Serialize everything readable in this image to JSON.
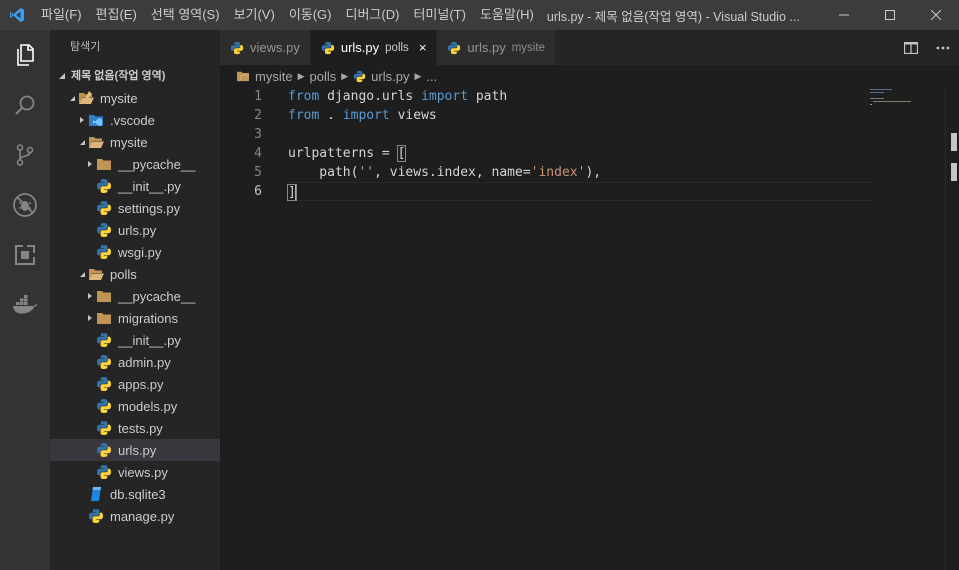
{
  "menu": [
    "파일(F)",
    "편집(E)",
    "선택 영역(S)",
    "보기(V)",
    "이동(G)",
    "디버그(D)",
    "터미널(T)",
    "도움말(H)"
  ],
  "window_title": "urls.py - 제목 없음(작업 영역) - Visual Studio ...",
  "sidebar": {
    "header": "탐색기",
    "workspace": "제목 없음(작업 영역)",
    "tree": [
      {
        "label": "mysite",
        "indent": 0,
        "type": "root",
        "expanded": true
      },
      {
        "label": ".vscode",
        "indent": 1,
        "type": "vscode-folder",
        "expanded": false
      },
      {
        "label": "mysite",
        "indent": 1,
        "type": "folder",
        "expanded": true
      },
      {
        "label": "__pycache__",
        "indent": 2,
        "type": "folder",
        "expanded": false
      },
      {
        "label": "__init__.py",
        "indent": 2,
        "type": "python"
      },
      {
        "label": "settings.py",
        "indent": 2,
        "type": "python"
      },
      {
        "label": "urls.py",
        "indent": 2,
        "type": "python"
      },
      {
        "label": "wsgi.py",
        "indent": 2,
        "type": "python"
      },
      {
        "label": "polls",
        "indent": 1,
        "type": "folder",
        "expanded": true
      },
      {
        "label": "__pycache__",
        "indent": 2,
        "type": "folder",
        "expanded": false
      },
      {
        "label": "migrations",
        "indent": 2,
        "type": "folder",
        "expanded": false
      },
      {
        "label": "__init__.py",
        "indent": 2,
        "type": "python"
      },
      {
        "label": "admin.py",
        "indent": 2,
        "type": "python"
      },
      {
        "label": "apps.py",
        "indent": 2,
        "type": "python"
      },
      {
        "label": "models.py",
        "indent": 2,
        "type": "python"
      },
      {
        "label": "tests.py",
        "indent": 2,
        "type": "python"
      },
      {
        "label": "urls.py",
        "indent": 2,
        "type": "python",
        "selected": true
      },
      {
        "label": "views.py",
        "indent": 2,
        "type": "python"
      },
      {
        "label": "db.sqlite3",
        "indent": 1,
        "type": "database"
      },
      {
        "label": "manage.py",
        "indent": 1,
        "type": "python"
      }
    ]
  },
  "tabs": [
    {
      "label": "views.py",
      "desc": "",
      "active": false
    },
    {
      "label": "urls.py",
      "desc": "polls",
      "active": true,
      "close": "×"
    },
    {
      "label": "urls.py",
      "desc": "mysite",
      "active": false
    }
  ],
  "breadcrumbs": [
    "mysite",
    "polls",
    "urls.py",
    "..."
  ],
  "editor": {
    "line_numbers": [
      "1",
      "2",
      "3",
      "4",
      "5",
      "6"
    ],
    "active_line": 6
  },
  "colors": {
    "keyword": "#569cd6",
    "string": "#ce9178",
    "python_blue": "#3572A5",
    "python_yellow": "#FFD43B",
    "folder": "#c09553",
    "vscode_blue": "#007acc"
  }
}
